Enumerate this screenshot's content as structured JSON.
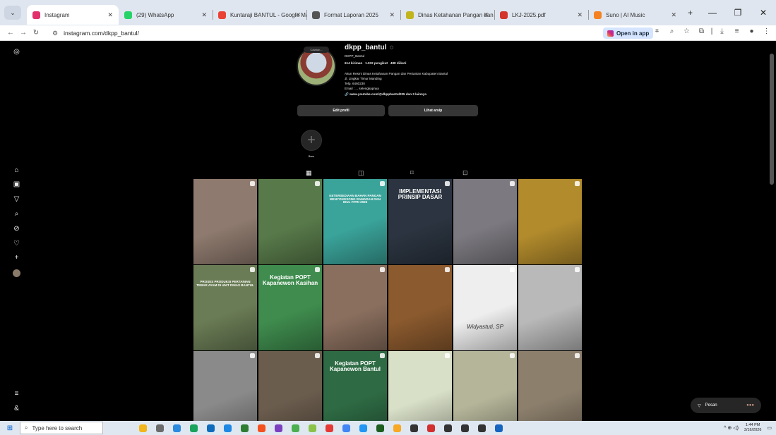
{
  "browser": {
    "tabs": [
      {
        "title": "Instagram",
        "color": "#e1306c",
        "active": true
      },
      {
        "title": "(29) WhatsApp",
        "color": "#25d366"
      },
      {
        "title": "Kuntaraji BANTUL - Google Ma",
        "color": "#e94235"
      },
      {
        "title": "Format Laporan 2025",
        "color": "#555555"
      },
      {
        "title": "Dinas Ketahanan Pangan dan P",
        "color": "#c2b51c"
      },
      {
        "title": "LKJ-2025.pdf",
        "color": "#d3342b"
      },
      {
        "title": "Suno | AI Music",
        "color": "#f58220"
      }
    ],
    "url": "instagram.com/dkpp_bantul/",
    "open_in_app": "Open in app"
  },
  "profile": {
    "username": "dkpp_bantul",
    "note": "Catatan...",
    "name": "DKPP_Bantul",
    "posts": "614 kiriman",
    "followers": "1.032 pengikut",
    "following": "488 diikuti",
    "bio_1": "Akun Resmi Dinas Ketahanan Pangan dan Pertanian Kabupaten Bantul",
    "bio_2": "Jl. Lingkar Timur Manding",
    "bio_3": "Telp. 6460230",
    "bio_4": "Email : ... selengkapnya",
    "link": "www.youtube.com/@dkppbantul205 dan 3 lainnya",
    "edit_profile": "Edit profil",
    "view_archive": "Lihat arsip",
    "new_highlight": "Baru"
  },
  "posts": [
    {
      "bg": "#8e7a6e",
      "caption": ""
    },
    {
      "bg": "#587a4a",
      "caption": ""
    },
    {
      "bg": "#3aa39a",
      "caption": "KETERSEDIAAN BAHAN PANGAN MENYONGSONG RAMADAN DAN IDUL FITRI 2025"
    },
    {
      "bg": "#2b3440",
      "caption": "IMPLEMENTASI PRINSIP DASAR"
    },
    {
      "bg": "#7c7a80",
      "caption": ""
    },
    {
      "bg": "#b28b2c",
      "caption": ""
    },
    {
      "bg": "#6a7c55",
      "caption": "PROSES PRODUKSI PERTANIAN TEBAR AYAM DI UNIT DINAS BANTUL"
    },
    {
      "bg": "#3f8c4e",
      "caption": "Kegiatan POPT Kapanewon Kasihan"
    },
    {
      "bg": "#8a6f5e",
      "caption": ""
    },
    {
      "bg": "#8b5a2e",
      "caption": ""
    },
    {
      "bg": "#eeeeee",
      "caption": "Widyastuti, SP"
    },
    {
      "bg": "#b9b9b9",
      "caption": ""
    },
    {
      "bg": "#8a8a8a",
      "caption": ""
    },
    {
      "bg": "#6b5d4e",
      "caption": ""
    },
    {
      "bg": "#2e6b44",
      "caption": "Kegiatan POPT Kapanewon Bantul"
    },
    {
      "bg": "#d9e0c8",
      "caption": ""
    },
    {
      "bg": "#b5b59a",
      "caption": ""
    },
    {
      "bg": "#8c7f6c",
      "caption": ""
    }
  ],
  "messages": {
    "label": "Pesan"
  },
  "taskbar": {
    "search_placeholder": "Type here to search",
    "time": "1:44 PM",
    "date": "3/16/2026"
  }
}
